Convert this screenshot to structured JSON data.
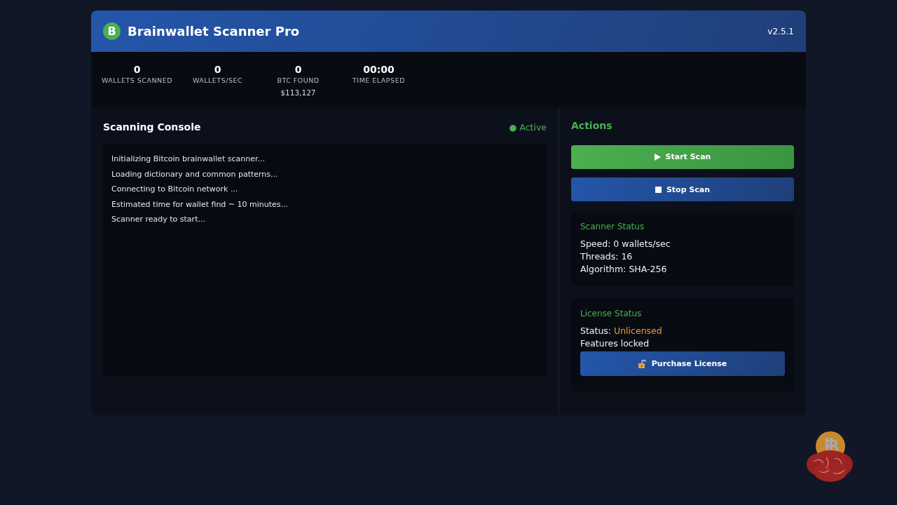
{
  "header": {
    "logo_letter": "B",
    "title": "Brainwallet Scanner Pro",
    "version": "v2.5.1"
  },
  "stats": [
    {
      "value": "0",
      "label": "WALLETS SCANNED"
    },
    {
      "value": "0",
      "label": "WALLETS/SEC"
    },
    {
      "value": "0",
      "label": "BTC FOUND",
      "sub": "$113,127"
    },
    {
      "value": "00:00",
      "label": "TIME ELAPSED"
    }
  ],
  "console": {
    "title": "Scanning Console",
    "status": "● Active",
    "lines": [
      "Initializing Bitcoin brainwallet scanner...",
      "Loading dictionary and common patterns...",
      "Connecting to Bitcoin network ...",
      "Estimated time for wallet find ~ 10 minutes...",
      "Scanner ready to start..."
    ]
  },
  "actions": {
    "title": "Actions",
    "buttons": [
      {
        "kind": "start",
        "label": "Start Scan"
      },
      {
        "kind": "stop",
        "label": "Stop Scan"
      }
    ]
  },
  "scanner_status": {
    "title": "Scanner Status",
    "lines": [
      "Speed: 0 wallets/sec",
      "Threads: 16",
      "Algorithm: SHA-256"
    ]
  },
  "license_status": {
    "title": "License Status",
    "status_label": "Status:",
    "status_value": "Unlicensed",
    "note": "Features locked",
    "button": "Purchase License"
  }
}
